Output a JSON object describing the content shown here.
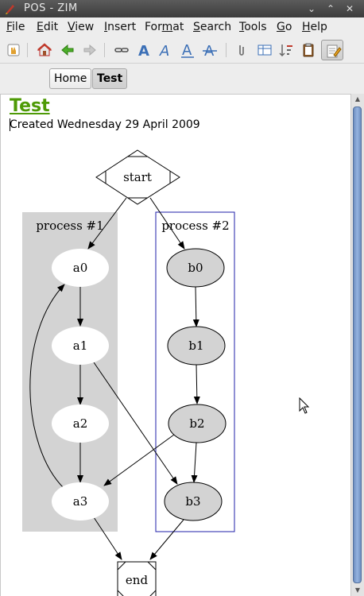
{
  "window": {
    "title": "POS - ZIM",
    "min_glyph": "⌄",
    "max_glyph": "⌃",
    "close_glyph": "✕"
  },
  "menu": {
    "items": [
      {
        "first": "F",
        "rest": "ile"
      },
      {
        "first": "E",
        "rest": "dit"
      },
      {
        "first": "V",
        "rest": "iew"
      },
      {
        "first": "I",
        "rest": "nsert"
      },
      {
        "first": "",
        "rest": "Format",
        "ul_index": 3
      },
      {
        "first": "S",
        "rest": "earch"
      },
      {
        "first": "T",
        "rest": "ools"
      },
      {
        "first": "G",
        "rest": "o"
      },
      {
        "first": "H",
        "rest": "elp"
      }
    ]
  },
  "toolbar": {
    "icons": [
      "hand-icon",
      "home-icon",
      "back-arrow-icon",
      "forward-arrow-icon",
      "link-icon",
      "bold-icon",
      "italic-icon",
      "underline-icon",
      "strike-icon",
      "attach-icon",
      "table-icon",
      "sort-icon",
      "clipboard-icon",
      "edit-toggle-icon"
    ],
    "format_letter": "A"
  },
  "pathbar": {
    "home_label": "Home",
    "current_label": "Test"
  },
  "page": {
    "heading": "Test",
    "created": "Created Wednesday 29 April 2009"
  },
  "graph": {
    "start": "start",
    "end": "end",
    "cluster1_label": "process #1",
    "cluster2_label": "process #2",
    "a0": "a0",
    "a1": "a1",
    "a2": "a2",
    "a3": "a3",
    "b0": "b0",
    "b1": "b1",
    "b2": "b2",
    "b3": "b3"
  },
  "colors": {
    "heading": "#4e9a06",
    "cluster1_fill": "#d3d3d3",
    "cluster2_stroke": "#1f1faa",
    "b_node_fill": "#d3d3d3"
  }
}
